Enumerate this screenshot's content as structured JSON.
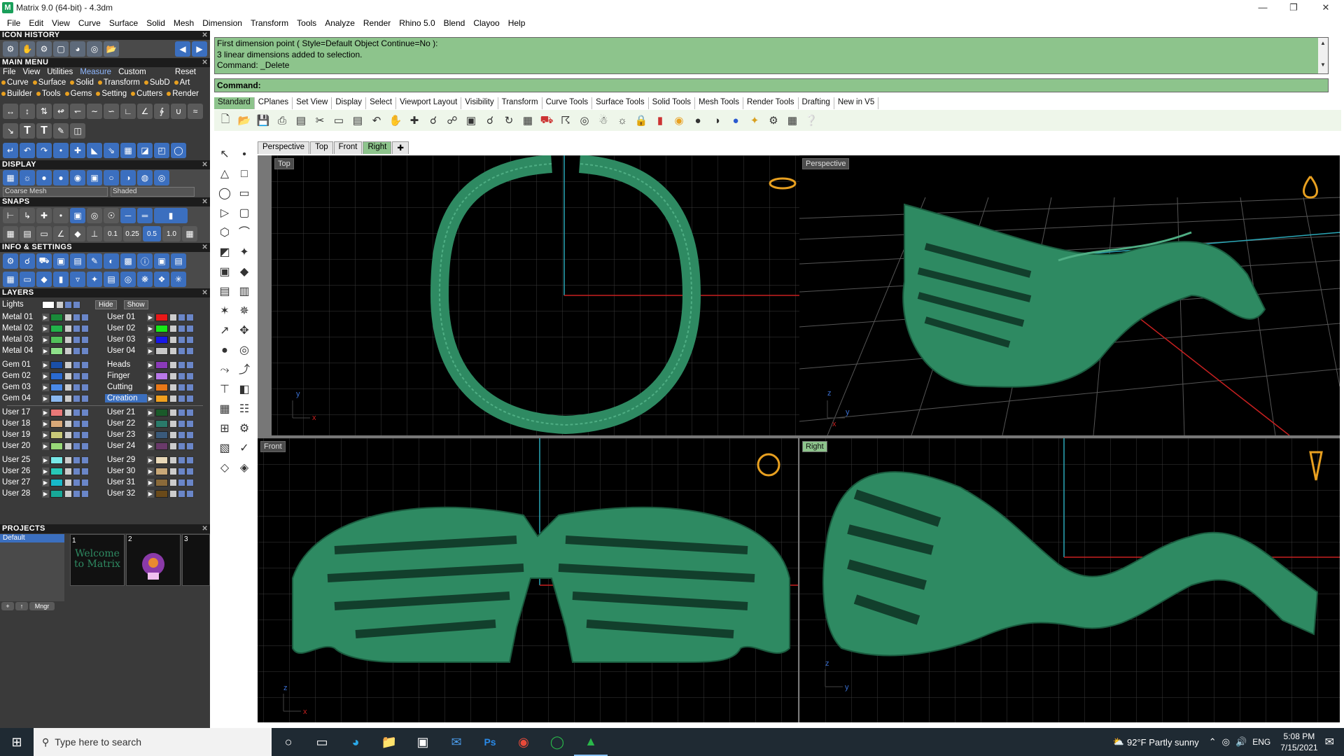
{
  "window": {
    "title": "Matrix 9.0 (64-bit) - 4.3dm"
  },
  "menubar": [
    "File",
    "Edit",
    "View",
    "Curve",
    "Surface",
    "Solid",
    "Mesh",
    "Dimension",
    "Transform",
    "Tools",
    "Analyze",
    "Render",
    "Rhino 5.0",
    "Blend",
    "Clayoo",
    "Help"
  ],
  "panel": {
    "icon_history": "ICON HISTORY",
    "main_menu": "MAIN MENU",
    "main_tabs": [
      "File",
      "View",
      "Utilities",
      "Measure",
      "Custom",
      "Reset"
    ],
    "main_row1": [
      "Curve",
      "Surface",
      "Solid",
      "Transform",
      "SubD",
      "Art"
    ],
    "main_row2": [
      "Builder",
      "Tools",
      "Gems",
      "Setting",
      "Cutters",
      "Render"
    ],
    "display": "DISPLAY",
    "display_mesh": "Coarse Mesh",
    "display_mode": "Shaded",
    "snaps": "SNAPS",
    "snap_values": [
      "0.1",
      "0.25",
      "0.5",
      "1.0"
    ],
    "info": "INFO & SETTINGS",
    "layers": "LAYERS",
    "lights": "Lights",
    "hide": "Hide",
    "show": "Show",
    "projects": "PROJECTS",
    "project_default": "Default",
    "project_thumb1": "Welcome to Matrix",
    "project_nums": [
      "1",
      "2",
      "3"
    ],
    "mngr": "Mngr"
  },
  "layers_left": [
    {
      "name": "Metal 01",
      "color": "#1a8a3a"
    },
    {
      "name": "Metal 02",
      "color": "#22b24a"
    },
    {
      "name": "Metal 03",
      "color": "#52c25a"
    },
    {
      "name": "Metal 04",
      "color": "#8ee08a"
    },
    {
      "name": "Gem 01",
      "color": "#1a4fa8"
    },
    {
      "name": "Gem 02",
      "color": "#2a6ad0"
    },
    {
      "name": "Gem 03",
      "color": "#4a8ae8"
    },
    {
      "name": "Gem 04",
      "color": "#8ab8f0"
    },
    {
      "name": "User 17",
      "color": "#e87878"
    },
    {
      "name": "User 18",
      "color": "#d8a878"
    },
    {
      "name": "User 19",
      "color": "#c8c878"
    },
    {
      "name": "User 20",
      "color": "#98d878"
    },
    {
      "name": "User 25",
      "color": "#78e8e8"
    },
    {
      "name": "User 26",
      "color": "#28c8b8"
    },
    {
      "name": "User 27",
      "color": "#18b8c8"
    },
    {
      "name": "User 28",
      "color": "#18a898"
    }
  ],
  "layers_right": [
    {
      "name": "User 01",
      "color": "#e81818"
    },
    {
      "name": "User 02",
      "color": "#18e818"
    },
    {
      "name": "User 03",
      "color": "#1818e8"
    },
    {
      "name": "User 04",
      "color": "#c8c8c8"
    },
    {
      "name": "Heads",
      "color": "#8a3ab8"
    },
    {
      "name": "Finger",
      "color": "#b878e8"
    },
    {
      "name": "Cutting",
      "color": "#e87818"
    },
    {
      "name": "Creation",
      "color": "#f0a020"
    },
    {
      "name": "User 21",
      "color": "#1a5a2a"
    },
    {
      "name": "User 22",
      "color": "#2a7a6a"
    },
    {
      "name": "User 23",
      "color": "#3a5a7a"
    },
    {
      "name": "User 24",
      "color": "#6a3a6a"
    },
    {
      "name": "User 29",
      "color": "#e8d8b8"
    },
    {
      "name": "User 30",
      "color": "#c8a878"
    },
    {
      "name": "User 31",
      "color": "#8a6a3a"
    },
    {
      "name": "User 32",
      "color": "#6a4a1a"
    }
  ],
  "command": {
    "history": [
      "First dimension point ( Style=Default  Object  Continue=No ):",
      "3 linear dimensions added to selection.",
      "Command: _Delete"
    ],
    "prompt": "Command:"
  },
  "toolbar_tabs": [
    "Standard",
    "CPlanes",
    "Set View",
    "Display",
    "Select",
    "Viewport Layout",
    "Visibility",
    "Transform",
    "Curve Tools",
    "Surface Tools",
    "Solid Tools",
    "Mesh Tools",
    "Render Tools",
    "Drafting",
    "New in V5"
  ],
  "viewport_tabs": [
    "Perspective",
    "Top",
    "Front",
    "Right"
  ],
  "viewports": {
    "top": "Top",
    "perspective": "Perspective",
    "front": "Front",
    "right": "Right"
  },
  "taskbar": {
    "search_placeholder": "Type here to search",
    "weather": "92°F  Partly sunny",
    "lang": "ENG",
    "time": "5:08 PM",
    "date": "7/15/2021"
  },
  "colors": {
    "accent": "#8dc48c",
    "model": "#2e8a62",
    "model_edge": "#1a5a3e"
  }
}
